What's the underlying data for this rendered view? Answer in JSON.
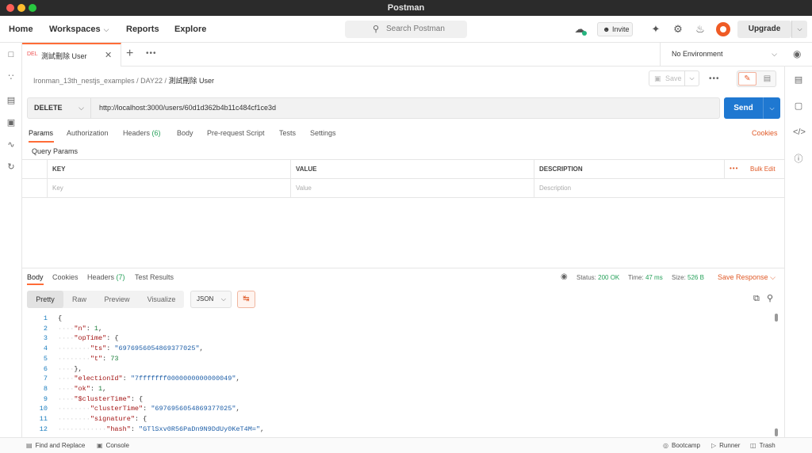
{
  "window": {
    "title": "Postman"
  },
  "header": {
    "nav": [
      "Home",
      "Workspaces",
      "Reports",
      "Explore"
    ],
    "search_placeholder": "Search Postman",
    "invite_label": "Invite",
    "upgrade_label": "Upgrade"
  },
  "tabs": {
    "active": {
      "method": "DEL",
      "name": "測試刪除 User"
    },
    "environment": "No Environment"
  },
  "breadcrumb": {
    "collection": "Ironman_13th_nestjs_examples",
    "folder": "DAY22",
    "request": "測試刪除 User",
    "save_label": "Save"
  },
  "request": {
    "method": "DELETE",
    "url": "http://localhost:3000/users/60d1d362b4b11c484cf1ce3d",
    "send_label": "Send",
    "tabs": [
      {
        "label": "Params"
      },
      {
        "label": "Authorization"
      },
      {
        "label": "Headers",
        "count": "(6)"
      },
      {
        "label": "Body"
      },
      {
        "label": "Pre-request Script"
      },
      {
        "label": "Tests"
      },
      {
        "label": "Settings"
      }
    ],
    "cookies_label": "Cookies",
    "section_label": "Query Params",
    "table": {
      "headers": [
        "KEY",
        "VALUE",
        "DESCRIPTION"
      ],
      "placeholders": [
        "Key",
        "Value",
        "Description"
      ],
      "bulk_edit": "Bulk Edit"
    }
  },
  "response": {
    "tabs": [
      {
        "label": "Body"
      },
      {
        "label": "Cookies"
      },
      {
        "label": "Headers",
        "count": "(7)"
      },
      {
        "label": "Test Results"
      }
    ],
    "status_label": "Status:",
    "status_value": "200 OK",
    "time_label": "Time:",
    "time_value": "47 ms",
    "size_label": "Size:",
    "size_value": "526 B",
    "save_response": "Save Response",
    "formats": [
      "Pretty",
      "Raw",
      "Preview",
      "Visualize"
    ],
    "language": "JSON",
    "lines": [
      {
        "n": "1",
        "indent": 0,
        "parts": [
          [
            "p",
            "{"
          ]
        ]
      },
      {
        "n": "2",
        "indent": 1,
        "parts": [
          [
            "k",
            "\"n\""
          ],
          [
            "p",
            ": "
          ],
          [
            "n",
            "1"
          ],
          [
            "p",
            ","
          ]
        ]
      },
      {
        "n": "3",
        "indent": 1,
        "parts": [
          [
            "k",
            "\"opTime\""
          ],
          [
            "p",
            ": {"
          ]
        ]
      },
      {
        "n": "4",
        "indent": 2,
        "parts": [
          [
            "k",
            "\"ts\""
          ],
          [
            "p",
            ": "
          ],
          [
            "s",
            "\"6976956054869377025\""
          ],
          [
            "p",
            ","
          ]
        ]
      },
      {
        "n": "5",
        "indent": 2,
        "parts": [
          [
            "k",
            "\"t\""
          ],
          [
            "p",
            ": "
          ],
          [
            "n",
            "73"
          ]
        ]
      },
      {
        "n": "6",
        "indent": 1,
        "parts": [
          [
            "p",
            "},"
          ]
        ]
      },
      {
        "n": "7",
        "indent": 1,
        "parts": [
          [
            "k",
            "\"electionId\""
          ],
          [
            "p",
            ": "
          ],
          [
            "s",
            "\"7fffffff0000000000000049\""
          ],
          [
            "p",
            ","
          ]
        ]
      },
      {
        "n": "8",
        "indent": 1,
        "parts": [
          [
            "k",
            "\"ok\""
          ],
          [
            "p",
            ": "
          ],
          [
            "n",
            "1"
          ],
          [
            "p",
            ","
          ]
        ]
      },
      {
        "n": "9",
        "indent": 1,
        "parts": [
          [
            "k",
            "\"$clusterTime\""
          ],
          [
            "p",
            ": {"
          ]
        ]
      },
      {
        "n": "10",
        "indent": 2,
        "parts": [
          [
            "k",
            "\"clusterTime\""
          ],
          [
            "p",
            ": "
          ],
          [
            "s",
            "\"6976956054869377025\""
          ],
          [
            "p",
            ","
          ]
        ]
      },
      {
        "n": "11",
        "indent": 2,
        "parts": [
          [
            "k",
            "\"signature\""
          ],
          [
            "p",
            ": {"
          ]
        ]
      },
      {
        "n": "12",
        "indent": 3,
        "parts": [
          [
            "k",
            "\"hash\""
          ],
          [
            "p",
            ": "
          ],
          [
            "s",
            "\"GTlSxv0R56PaDn9N9DdUy0KeT4M=\""
          ],
          [
            "p",
            ","
          ]
        ]
      }
    ]
  },
  "footer": {
    "find_replace": "Find and Replace",
    "console": "Console",
    "bootcamp": "Bootcamp",
    "runner": "Runner",
    "trash": "Trash"
  }
}
